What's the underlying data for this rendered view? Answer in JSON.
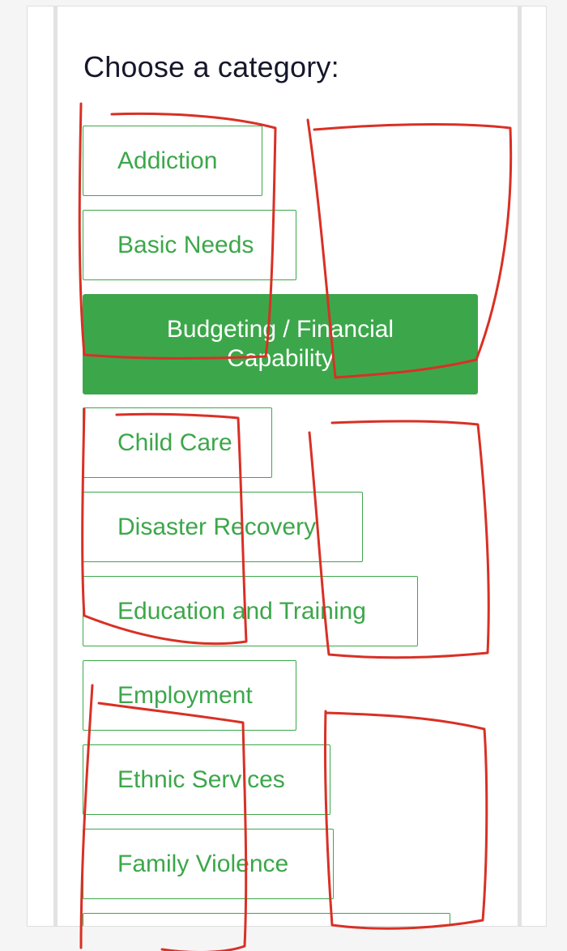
{
  "page": {
    "title": "Choose a category:"
  },
  "categories": [
    {
      "id": "addiction",
      "label": "Addiction",
      "selected": false
    },
    {
      "id": "basic-needs",
      "label": "Basic Needs",
      "selected": false
    },
    {
      "id": "budgeting",
      "label": "Budgeting / Financial Capability",
      "selected": true
    },
    {
      "id": "child-care",
      "label": "Child Care",
      "selected": false
    },
    {
      "id": "disaster-recovery",
      "label": "Disaster Recovery",
      "selected": false
    },
    {
      "id": "education-training",
      "label": "Education and Training",
      "selected": false
    },
    {
      "id": "employment",
      "label": "Employment",
      "selected": false
    },
    {
      "id": "ethnic-services",
      "label": "Ethnic Services",
      "selected": false
    },
    {
      "id": "family-violence",
      "label": "Family Violence",
      "selected": false
    },
    {
      "id": "next-partial",
      "label": "",
      "selected": false
    }
  ],
  "colors": {
    "accent": "#3ca74a",
    "title_text": "#15172a",
    "annotation": "#d93025"
  }
}
